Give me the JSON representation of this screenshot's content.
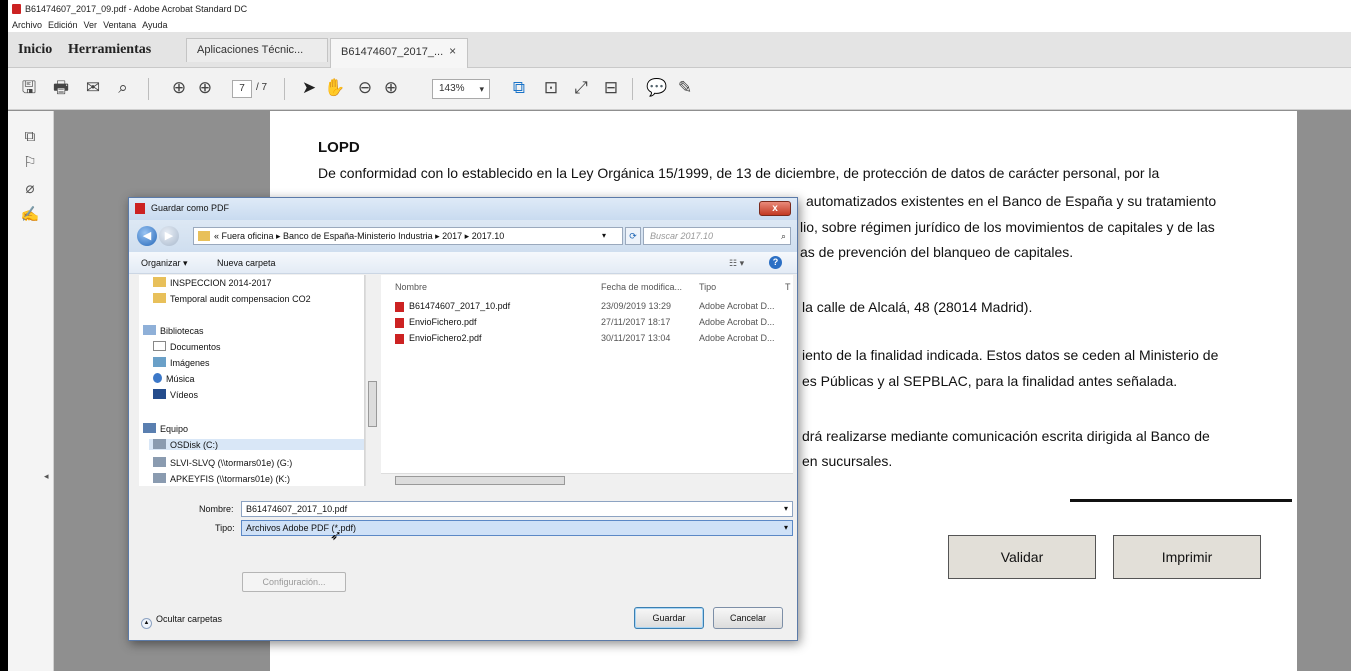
{
  "window": {
    "title": "B61474607_2017_09.pdf - Adobe Acrobat Standard DC"
  },
  "menu": [
    "Archivo",
    "Edición",
    "Ver",
    "Ventana",
    "Ayuda"
  ],
  "tabs": {
    "home": "Inicio",
    "tools": "Herramientas",
    "doc1": "Aplicaciones Técnic...",
    "doc2": "B61474607_2017_...",
    "close": "×"
  },
  "toolbar": {
    "page_current": "7",
    "page_total": "/ 7",
    "zoom": "143%"
  },
  "pdf": {
    "heading": "LOPD",
    "lines": [
      "De conformidad con lo establecido en la Ley Orgánica 15/1999, de 13 de diciembre, de protección de datos de carácter personal, por la",
      "automatizados existentes en el Banco de España y su tratamiento",
      "lio, sobre régimen jurídico de los movimientos de capitales y de las",
      "as de prevención del blanqueo de capitales.",
      "la calle de Alcalá, 48 (28014 Madrid).",
      "iento de la finalidad indicada. Estos datos se ceden al Ministerio de",
      "es Públicas y al SEPBLAC, para la finalidad antes señalada.",
      "drá realizarse mediante comunicación escrita dirigida al Banco de",
      "en sucursales."
    ],
    "btn_validate": "Validar",
    "btn_print": "Imprimir"
  },
  "dialog": {
    "title": "Guardar como PDF",
    "close": "x",
    "path": "« Fuera oficina ▸ Banco de España-Ministerio Industria ▸ 2017 ▸ 2017.10",
    "search_placeholder": "Buscar 2017.10",
    "organize": "Organizar ▾",
    "new_folder": "Nueva carpeta",
    "nav_items": [
      {
        "label": "INSPECCION 2014-2017",
        "icon": "folder"
      },
      {
        "label": "Temporal audit compensacion CO2",
        "icon": "folder"
      },
      {
        "label": "Bibliotecas",
        "icon": "lib"
      },
      {
        "label": "Documentos",
        "icon": "doc"
      },
      {
        "label": "Imágenes",
        "icon": "img"
      },
      {
        "label": "Música",
        "icon": "mus"
      },
      {
        "label": "Vídeos",
        "icon": "vid"
      },
      {
        "label": "Equipo",
        "icon": "pc"
      },
      {
        "label": "OSDisk (C:)",
        "icon": "drv"
      },
      {
        "label": "SLVI-SLVQ (\\\\tormars01e) (G:)",
        "icon": "drv"
      },
      {
        "label": "APKEYFIS (\\\\tormars01e) (K:)",
        "icon": "drv"
      }
    ],
    "columns": {
      "name": "Nombre",
      "date": "Fecha de modifica...",
      "type": "Tipo",
      "extra": "T"
    },
    "files": [
      {
        "name": "B61474607_2017_10.pdf",
        "date": "23/09/2019 13:29",
        "type": "Adobe Acrobat D..."
      },
      {
        "name": "EnvioFichero.pdf",
        "date": "27/11/2017 18:17",
        "type": "Adobe Acrobat D..."
      },
      {
        "name": "EnvioFichero2.pdf",
        "date": "30/11/2017 13:04",
        "type": "Adobe Acrobat D..."
      }
    ],
    "name_label": "Nombre:",
    "name_value": "B61474607_2017_10.pdf",
    "type_label": "Tipo:",
    "type_value": "Archivos Adobe PDF (*.pdf)",
    "config_btn": "Configuración...",
    "hide_folders": "Ocultar carpetas",
    "save_btn": "Guardar",
    "cancel_btn": "Cancelar"
  }
}
